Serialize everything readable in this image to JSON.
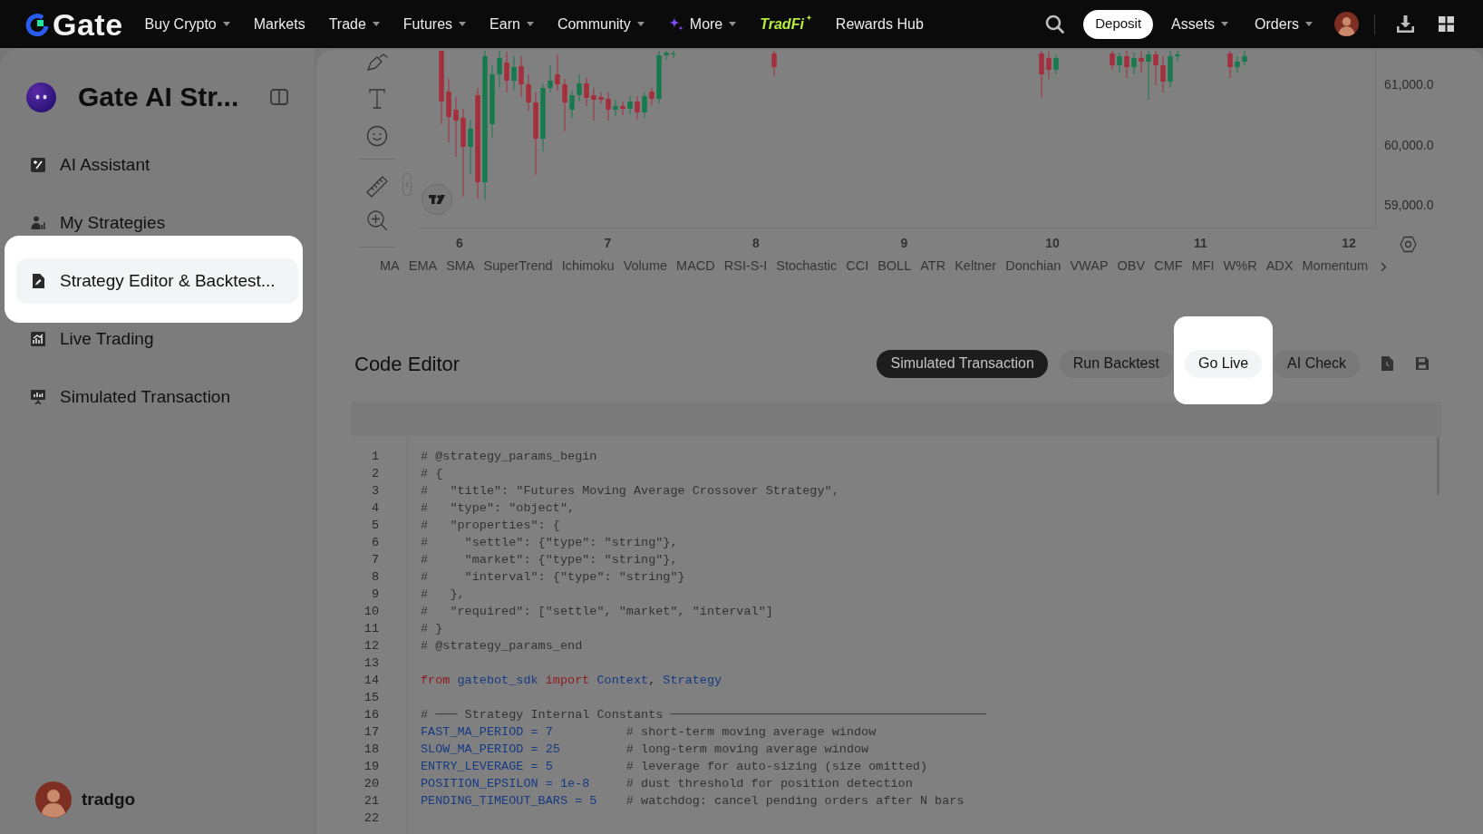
{
  "nav": {
    "logo": "Gate",
    "items": [
      {
        "label": "Buy Crypto",
        "kind": "menu"
      },
      {
        "label": "Markets",
        "kind": "link"
      },
      {
        "label": "Trade",
        "kind": "menu"
      },
      {
        "label": "Futures",
        "kind": "menu"
      },
      {
        "label": "Earn",
        "kind": "menu"
      },
      {
        "label": "Community",
        "kind": "menu"
      },
      {
        "label": "More",
        "kind": "ai_menu"
      },
      {
        "label": "TradFi",
        "kind": "promo"
      },
      {
        "label": "Rewards Hub",
        "kind": "link"
      }
    ],
    "deposit_button": "Deposit",
    "account_menus": [
      {
        "label": "Assets",
        "kind": "menu"
      },
      {
        "label": "Orders",
        "kind": "menu"
      }
    ]
  },
  "sidebar": {
    "title": "Gate AI Str...",
    "items": [
      {
        "label": "AI Assistant",
        "selected": false,
        "highlighted": false
      },
      {
        "label": "My Strategies",
        "selected": false,
        "highlighted": false
      },
      {
        "label": "Strategy Editor & Backtest...",
        "selected": true,
        "highlighted": true
      },
      {
        "label": "Live Trading",
        "selected": false,
        "highlighted": false
      },
      {
        "label": "Simulated Transaction",
        "selected": false,
        "highlighted": false
      }
    ],
    "user": {
      "name": "tradgo"
    }
  },
  "chart": {
    "price_labels": [
      "61,000.0",
      "60,000.0",
      "59,000.0"
    ],
    "date_labels": [
      "6",
      "7",
      "8",
      "9",
      "10",
      "11",
      "12"
    ],
    "indicators": [
      "MA",
      "EMA",
      "SMA",
      "SuperTrend",
      "Ichimoku",
      "Volume",
      "MACD",
      "RSI-S-I",
      "Stochastic",
      "CCI",
      "BOLL",
      "ATR",
      "Keltner",
      "Donchian",
      "VWAP",
      "OBV",
      "CMF",
      "MFI",
      "W%R",
      "ADX",
      "Momentum"
    ]
  },
  "code_editor": {
    "title": "Code Editor",
    "buttons": [
      {
        "label": "Simulated Transaction",
        "kind": "primary",
        "highlighted": false
      },
      {
        "label": "Run Backtest",
        "kind": "secondary",
        "highlighted": false
      },
      {
        "label": "Go Live",
        "kind": "secondary",
        "highlighted": true
      },
      {
        "label": "AI Check",
        "kind": "secondary",
        "highlighted": false
      }
    ],
    "lines": [
      {
        "number": "1",
        "tokens": [
          {
            "kind": "comment",
            "text": "# @strategy_params_begin"
          }
        ]
      },
      {
        "number": "2",
        "tokens": [
          {
            "kind": "comment",
            "text": "# {"
          }
        ]
      },
      {
        "number": "3",
        "tokens": [
          {
            "kind": "comment",
            "text": "#   \"title\": \"Futures Moving Average Crossover Strategy\","
          }
        ]
      },
      {
        "number": "4",
        "tokens": [
          {
            "kind": "comment",
            "text": "#   \"type\": \"object\","
          }
        ]
      },
      {
        "number": "5",
        "tokens": [
          {
            "kind": "comment",
            "text": "#   \"properties\": {"
          }
        ]
      },
      {
        "number": "6",
        "tokens": [
          {
            "kind": "comment",
            "text": "#     \"settle\": {\"type\": \"string\"},"
          }
        ]
      },
      {
        "number": "7",
        "tokens": [
          {
            "kind": "comment",
            "text": "#     \"market\": {\"type\": \"string\"},"
          }
        ]
      },
      {
        "number": "8",
        "tokens": [
          {
            "kind": "comment",
            "text": "#     \"interval\": {\"type\": \"string\"}"
          }
        ]
      },
      {
        "number": "9",
        "tokens": [
          {
            "kind": "comment",
            "text": "#   },"
          }
        ]
      },
      {
        "number": "10",
        "tokens": [
          {
            "kind": "comment",
            "text": "#   \"required\": [\"settle\", \"market\", \"interval\"]"
          }
        ]
      },
      {
        "number": "11",
        "tokens": [
          {
            "kind": "comment",
            "text": "# }"
          }
        ]
      },
      {
        "number": "12",
        "tokens": [
          {
            "kind": "comment",
            "text": "# @strategy_params_end"
          }
        ]
      },
      {
        "number": "13"
      },
      {
        "number": "14",
        "tokens": [
          {
            "kind": "keyword",
            "text": "from"
          },
          {
            "kind": "name",
            "text": " gatebot_sdk"
          },
          {
            "kind": "keyword",
            "text": " import"
          },
          {
            "kind": "name",
            "text": " Context"
          },
          {
            "kind": "plain",
            "text": ", "
          },
          {
            "kind": "name",
            "text": "Strategy"
          }
        ]
      },
      {
        "number": "15"
      },
      {
        "number": "16",
        "tokens": [
          {
            "kind": "comment",
            "text": "# ─── Strategy Internal Constants ───────────────────────────────────────────"
          }
        ]
      },
      {
        "number": "17",
        "tokens": [
          {
            "kind": "name",
            "text": "FAST_MA_PERIOD = 7"
          },
          {
            "kind": "comment",
            "text": "          # short-term moving average window"
          }
        ]
      },
      {
        "number": "18",
        "tokens": [
          {
            "kind": "name",
            "text": "SLOW_MA_PERIOD = 25"
          },
          {
            "kind": "comment",
            "text": "         # long-term moving average window"
          }
        ]
      },
      {
        "number": "19",
        "tokens": [
          {
            "kind": "name",
            "text": "ENTRY_LEVERAGE = 5"
          },
          {
            "kind": "comment",
            "text": "          # leverage for auto-sizing (size omitted)"
          }
        ]
      },
      {
        "number": "20",
        "tokens": [
          {
            "kind": "name",
            "text": "POSITION_EPSILON = 1e-8"
          },
          {
            "kind": "comment",
            "text": "     # dust threshold for position detection"
          }
        ]
      },
      {
        "number": "21",
        "tokens": [
          {
            "kind": "name",
            "text": "PENDING_TIMEOUT_BARS = 5"
          },
          {
            "kind": "comment",
            "text": "    # watchdog: cancel pending orders after N bars"
          }
        ]
      },
      {
        "number": "22"
      }
    ]
  }
}
